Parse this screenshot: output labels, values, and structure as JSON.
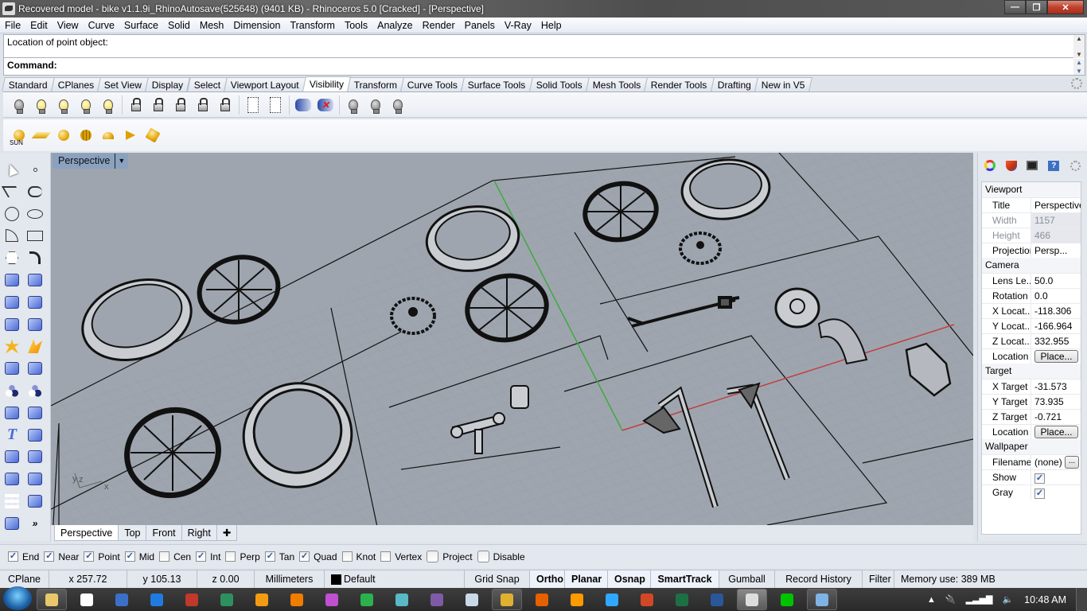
{
  "window": {
    "title": "Recovered model - bike v1.1.9i_RhinoAutosave(525648) (9401 KB) - Rhinoceros 5.0 [Cracked] - [Perspective]",
    "minimize": "—",
    "restore": "❐",
    "close": "✕"
  },
  "menu": [
    "File",
    "Edit",
    "View",
    "Curve",
    "Surface",
    "Solid",
    "Mesh",
    "Dimension",
    "Transform",
    "Tools",
    "Analyze",
    "Render",
    "Panels",
    "V-Ray",
    "Help"
  ],
  "command": {
    "history": "Location of point object:",
    "prompt": "Command:"
  },
  "toolbar_tabs": {
    "items": [
      "Standard",
      "CPlanes",
      "Set View",
      "Display",
      "Select",
      "Viewport Layout",
      "Visibility",
      "Transform",
      "Curve Tools",
      "Surface Tools",
      "Solid Tools",
      "Mesh Tools",
      "Render Tools",
      "Drafting",
      "New in V5"
    ],
    "active": "Visibility"
  },
  "visibility_toolbar": [
    {
      "icon": "hide-objects-icon"
    },
    {
      "icon": "show-objects-icon"
    },
    {
      "icon": "show-selected-objects-icon"
    },
    {
      "icon": "hide-swap-icon"
    },
    {
      "icon": "swap-hidden-visible-icon"
    },
    {
      "icon": "lock-objects-icon"
    },
    {
      "icon": "unlock-objects-icon"
    },
    {
      "icon": "unlock-selected-icon"
    },
    {
      "icon": "lock-swap-icon"
    },
    {
      "icon": "swap-locked-icon"
    },
    {
      "icon": "hide-points-icon"
    },
    {
      "icon": "show-points-icon"
    },
    {
      "icon": "hide-in-detail-icon"
    },
    {
      "icon": "show-in-detail-icon"
    },
    {
      "icon": "layer-off-icon"
    },
    {
      "icon": "layer-on-icon"
    },
    {
      "icon": "layer-isolate-icon"
    }
  ],
  "light_toolbar": [
    {
      "icon": "sun-icon",
      "label": "SUN"
    },
    {
      "icon": "directional-light-icon"
    },
    {
      "icon": "point-light-icon"
    },
    {
      "icon": "spot-light-grid-icon"
    },
    {
      "icon": "hemisphere-light-icon"
    },
    {
      "icon": "spotlight-icon"
    },
    {
      "icon": "linear-light-icon"
    }
  ],
  "left_tools": [
    "select-arrow-icon",
    "point-icon",
    "polyline-icon",
    "curve-control-points-icon",
    "circle-icon",
    "ellipse-icon",
    "arc-icon",
    "rectangle-icon",
    "polygon-icon",
    "fillet-curve-icon",
    "surface-from-points-icon",
    "extrude-surface-icon",
    "box-icon",
    "sphere-union-icon",
    "cylinder-icon",
    "surface-patch-icon",
    "explode-icon",
    "boolean-split-icon",
    "trim-icon",
    "split-icon",
    "group-icon",
    "ungroup-icon",
    "offset-curve-icon",
    "fillet-arc-icon",
    "text-icon",
    "move-icon",
    "array-icon",
    "mirror-icon",
    "solid-tools-icon",
    "extrude-vertical-icon",
    "grid-array-icon",
    "analyze-icon",
    "render-icon",
    "more-tools-icon"
  ],
  "viewport": {
    "label": "Perspective",
    "axes": {
      "x": "x",
      "y": "y",
      "z": "z"
    },
    "objects": [
      "tire",
      "spoked-wheel",
      "tire",
      "hub-disc",
      "spoked-wheel",
      "spoked-wheel",
      "tire",
      "hub-disc",
      "handlebar",
      "headlight-fender",
      "rear-bracket",
      "front-fork-left",
      "front-fork-right",
      "t-bracket",
      "small-cylinder",
      "tire",
      "spoked-wheel",
      "tire"
    ]
  },
  "view_tabs": {
    "items": [
      "Perspective",
      "Top",
      "Front",
      "Right"
    ],
    "active": "Perspective",
    "add": "✚"
  },
  "osnaps": [
    {
      "label": "End",
      "checked": true
    },
    {
      "label": "Near",
      "checked": true
    },
    {
      "label": "Point",
      "checked": true
    },
    {
      "label": "Mid",
      "checked": true
    },
    {
      "label": "Cen",
      "checked": false
    },
    {
      "label": "Int",
      "checked": true
    },
    {
      "label": "Perp",
      "checked": false
    },
    {
      "label": "Tan",
      "checked": true
    },
    {
      "label": "Quad",
      "checked": true
    },
    {
      "label": "Knot",
      "checked": false
    },
    {
      "label": "Vertex",
      "checked": false
    },
    {
      "label": "Project",
      "checked": false,
      "round": true
    },
    {
      "label": "Disable",
      "checked": false,
      "round": true
    }
  ],
  "status": {
    "cplane": "CPlane",
    "x": "x 257.72",
    "y": "y 105.13",
    "z": "z 0.00",
    "units": "Millimeters",
    "layer": "Default",
    "layer_color": "#000000",
    "toggles": [
      {
        "label": "Grid Snap",
        "on": false
      },
      {
        "label": "Ortho",
        "on": true
      },
      {
        "label": "Planar",
        "on": true
      },
      {
        "label": "Osnap",
        "on": true
      },
      {
        "label": "SmartTrack",
        "on": true
      },
      {
        "label": "Gumball",
        "on": false
      },
      {
        "label": "Record History",
        "on": false
      },
      {
        "label": "Filter",
        "on": false
      }
    ],
    "memory": "Memory use: 389 MB"
  },
  "properties": {
    "tabs": [
      "properties-color-icon",
      "material-icon",
      "display-icon",
      "help-icon"
    ],
    "viewport": {
      "heading": "Viewport",
      "rows": [
        {
          "k": "Title",
          "v": "Perspective",
          "disabled": false
        },
        {
          "k": "Width",
          "v": "1157",
          "disabled": true
        },
        {
          "k": "Height",
          "v": "466",
          "disabled": true
        },
        {
          "k": "Projection",
          "v": "Persp...",
          "dropdown": true
        }
      ]
    },
    "camera": {
      "heading": "Camera",
      "rows": [
        {
          "k": "Lens Le...",
          "v": "50.0"
        },
        {
          "k": "Rotation",
          "v": "0.0"
        },
        {
          "k": "X Locat...",
          "v": "-118.306"
        },
        {
          "k": "Y Locat...",
          "v": "-166.964"
        },
        {
          "k": "Z Locat...",
          "v": "332.955"
        },
        {
          "k": "Location",
          "button": "Place..."
        }
      ]
    },
    "target": {
      "heading": "Target",
      "rows": [
        {
          "k": "X Target",
          "v": "-31.573"
        },
        {
          "k": "Y Target",
          "v": "73.935"
        },
        {
          "k": "Z Target",
          "v": "-0.721"
        },
        {
          "k": "Location",
          "button": "Place..."
        }
      ]
    },
    "wallpaper": {
      "heading": "Wallpaper",
      "filename_label": "Filename",
      "filename": "(none)",
      "browse": "...",
      "show_label": "Show",
      "show": true,
      "gray_label": "Gray",
      "gray": true
    }
  },
  "taskbar": {
    "apps": [
      {
        "name": "file-explorer",
        "color": "#e8c86a",
        "pinned": true
      },
      {
        "name": "icloud",
        "color": "#ffffff"
      },
      {
        "name": "onedrive",
        "color": "#3c6fc8"
      },
      {
        "name": "dropbox",
        "color": "#1f7be0"
      },
      {
        "name": "app-red-ring",
        "color": "#c0392b"
      },
      {
        "name": "app-tiles",
        "color": "#2e8f5f"
      },
      {
        "name": "media-player",
        "color": "#f39c12"
      },
      {
        "name": "vlc",
        "color": "#f07d00"
      },
      {
        "name": "itunes",
        "color": "#c050d0"
      },
      {
        "name": "green-triangle-app",
        "color": "#2bb24c"
      },
      {
        "name": "shield-app",
        "color": "#5ab7c6"
      },
      {
        "name": "tor-app",
        "color": "#7f5aa6"
      },
      {
        "name": "notepad",
        "color": "#c9d9e8"
      },
      {
        "name": "chrome",
        "color": "#e0b030",
        "pinned": true
      },
      {
        "name": "firefox",
        "color": "#e66000"
      },
      {
        "name": "illustrator",
        "color": "#ff9a00"
      },
      {
        "name": "photoshop",
        "color": "#31a8ff"
      },
      {
        "name": "powerpoint",
        "color": "#d24726"
      },
      {
        "name": "excel",
        "color": "#1d7044"
      },
      {
        "name": "word",
        "color": "#2b579a"
      },
      {
        "name": "rhinoceros",
        "color": "#dddddd",
        "pinned": true,
        "active": true
      },
      {
        "name": "line",
        "color": "#00c300"
      },
      {
        "name": "paint",
        "color": "#7fb2e5",
        "pinned": true
      }
    ],
    "tray": {
      "show_hidden": "▲",
      "power": "🔌",
      "network": "▂▃▅▇",
      "volume": "🔈",
      "clock": "10:48 AM"
    }
  }
}
